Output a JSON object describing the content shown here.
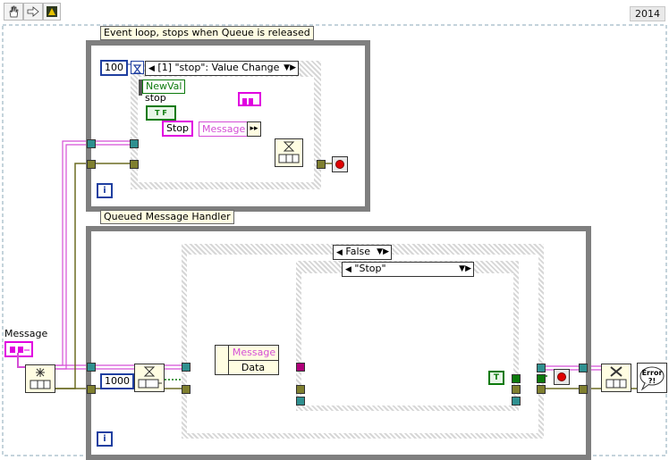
{
  "toolbar": {
    "run_icon": "hand-icon",
    "arrow_icon": "arrow-right-icon",
    "highlight_icon": "lightbulb-icon",
    "version": "2014"
  },
  "event_loop": {
    "label": "Event loop, stops when Queue is released",
    "timeout_const": "100",
    "event_selector": "[1] \"stop\": Value Change",
    "newval": "NewVal",
    "control_name": "stop",
    "tf": "T F",
    "stop_const": "Stop",
    "message_field": "Message",
    "iteration": "i"
  },
  "qmh": {
    "label": "Queued Message Handler",
    "timeout_const": "1000",
    "case_false": "False",
    "case_stop": "\"Stop\"",
    "cluster_field_message": "Message",
    "cluster_field_data": "Data",
    "true_const": "T",
    "iteration": "i"
  },
  "left_control": {
    "label": "Message"
  },
  "icons": {
    "obtain_queue": "star-icon",
    "enqueue": "hourglass-icon",
    "dequeue": "hourglass-icon",
    "release_queue": "x-icon",
    "error_handler": "error-icon",
    "stop_terminal": "stop-circle-icon"
  },
  "error_text": "Error ?!",
  "colors": {
    "string_wire": "#d54fd6",
    "error_wire": "#7f7f2f",
    "loop_border": "#7f7f7f",
    "numeric": "#1f3fa0",
    "boolean": "#0c7a0c",
    "stop_red": "#e00000"
  }
}
